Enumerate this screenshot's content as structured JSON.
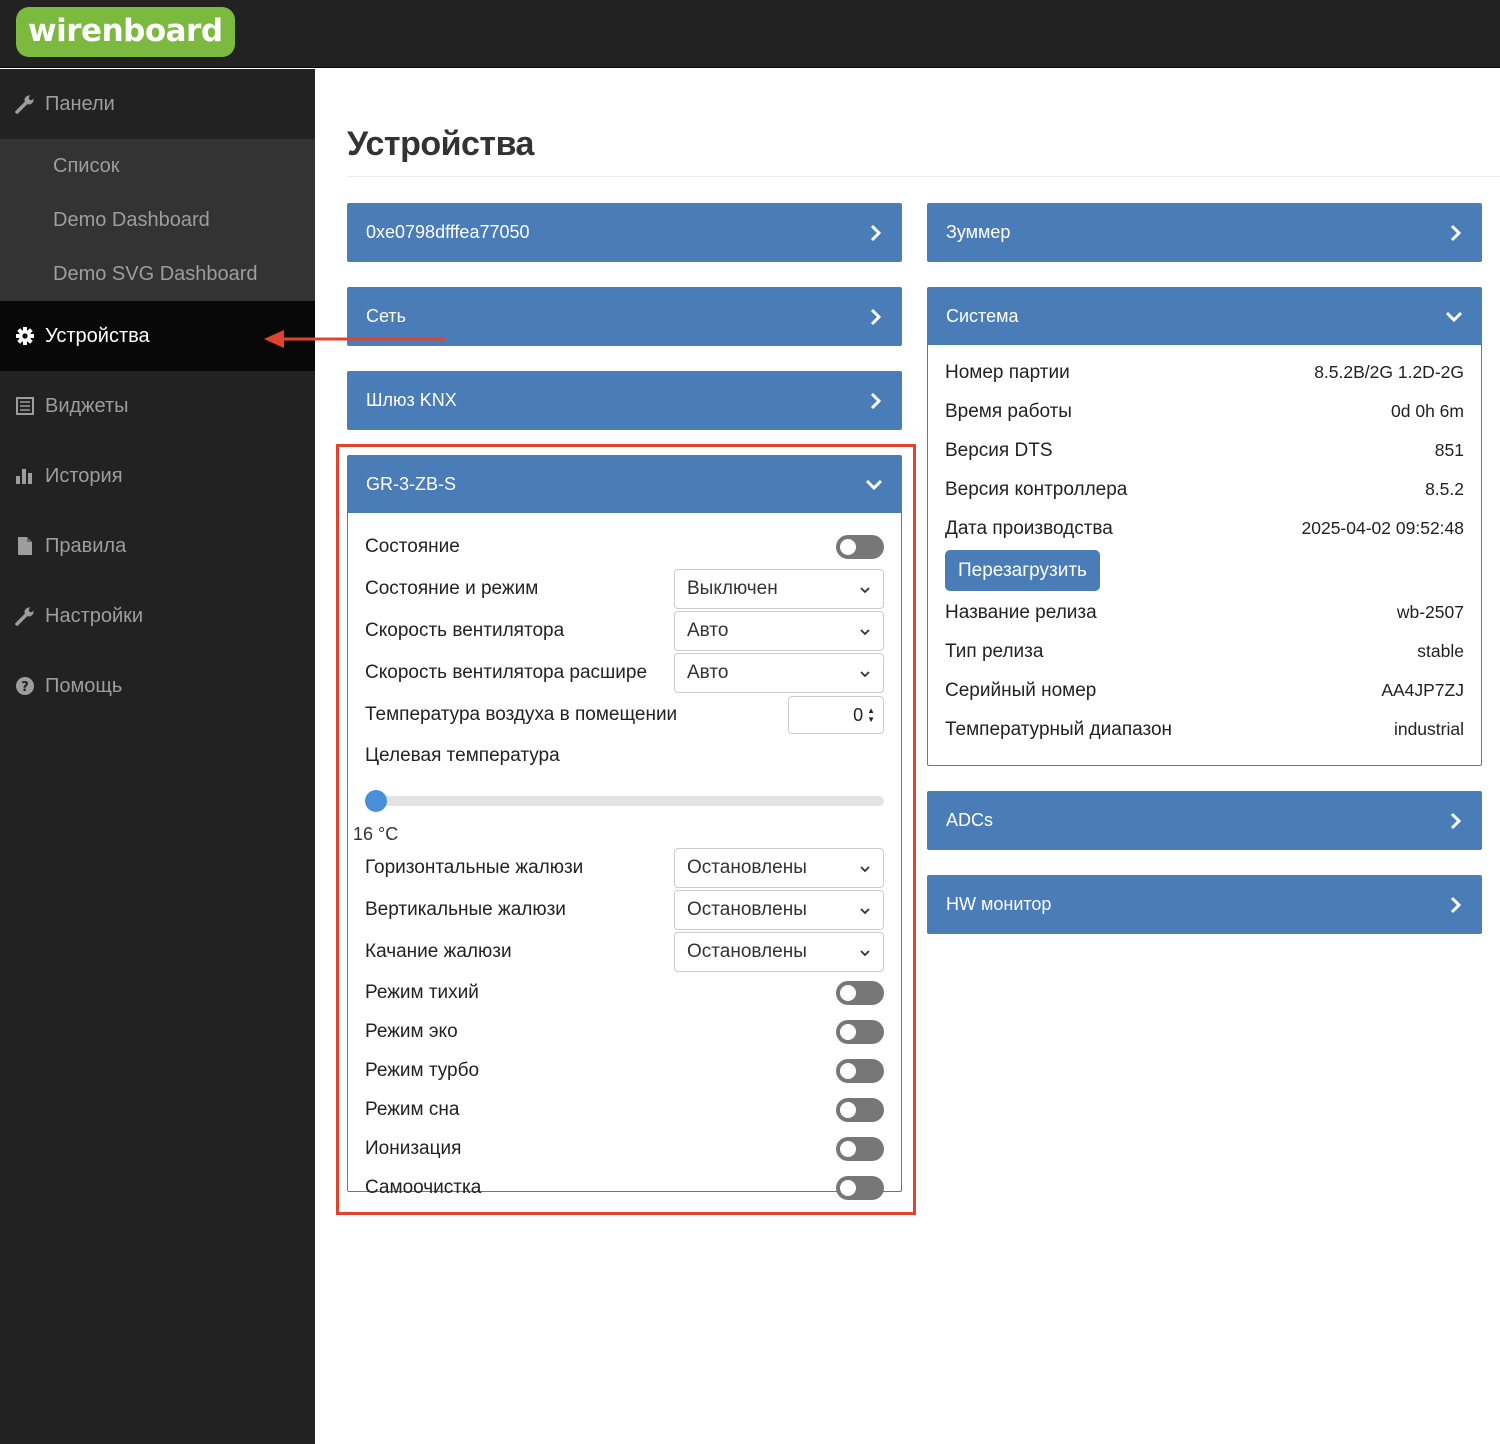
{
  "header": {
    "logo": "wirenboard"
  },
  "sidebar": {
    "panels": "Панели",
    "sub": [
      "Список",
      "Demo Dashboard",
      "Demo SVG Dashboard"
    ],
    "items": [
      "Устройства",
      "Виджеты",
      "История",
      "Правила",
      "Настройки",
      "Помощь"
    ]
  },
  "main": {
    "title": "Устройства"
  },
  "left_panels": [
    {
      "title": "0xe0798dfffea77050"
    },
    {
      "title": "Сеть"
    },
    {
      "title": "Шлюз KNX"
    }
  ],
  "device": {
    "title": "GR-3-ZB-S",
    "state_label": "Состояние",
    "mode_label": "Состояние и режим",
    "mode_value": "Выключен",
    "fan_label": "Скорость вентилятора",
    "fan_value": "Авто",
    "fan_ext_label": "Скорость вентилятора расшире",
    "fan_ext_value": "Авто",
    "room_temp_label": "Температура воздуха в помещении",
    "room_temp_value": "0",
    "target_label": "Целевая температура",
    "target_value_text": "16 °C",
    "target_level": 0,
    "hblinds_label": "Горизонтальные жалюзи",
    "hblinds_value": "Остановлены",
    "vblinds_label": "Вертикальные жалюзи",
    "vblinds_value": "Остановлены",
    "swing_label": "Качание жалюзи",
    "swing_value": "Остановлены",
    "toggles": [
      "Режим тихий",
      "Режим эко",
      "Режим турбо",
      "Режим сна",
      "Ионизация",
      "Самоочистка"
    ]
  },
  "right_panels": {
    "buzzer": "Зуммер",
    "system": {
      "title": "Система",
      "rows": [
        {
          "k": "Номер партии",
          "v": "8.5.2B/2G 1.2D-2G"
        },
        {
          "k": "Время работы",
          "v": "0d 0h 6m"
        },
        {
          "k": "Версия DTS",
          "v": "851"
        },
        {
          "k": "Версия контроллера",
          "v": "8.5.2"
        },
        {
          "k": "Дата производства",
          "v": "2025-04-02 09:52:48"
        }
      ],
      "reboot": "Перезагрузить",
      "rows2": [
        {
          "k": "Название релиза",
          "v": "wb-2507"
        },
        {
          "k": "Тип релиза",
          "v": "stable"
        },
        {
          "k": "Серийный номер",
          "v": "AA4JP7ZJ"
        },
        {
          "k": "Температурный диапазон",
          "v": "industrial"
        }
      ]
    },
    "adcs": "ADCs",
    "hw": "HW монитор"
  },
  "colors": {
    "panel_header": "#4a7cb7",
    "logo_bg": "#7cb93f",
    "highlight": "#e0442e",
    "sidebar_bg": "#222222"
  }
}
